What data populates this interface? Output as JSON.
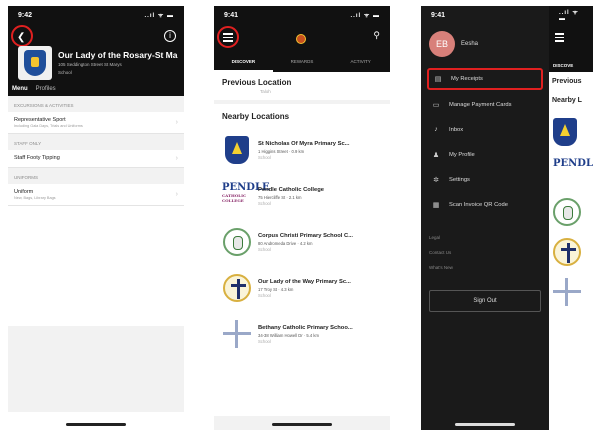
{
  "phone1": {
    "status_time": "9:42",
    "status_right": "..ıl ᯤ ▬",
    "school_name": "Our Lady of the Rosary-St Mar...",
    "school_address": "105 Seddington Street St Marys",
    "school_type": "School",
    "tabs": [
      "Menu",
      "Profiles"
    ],
    "sections": [
      {
        "header": "EXCURSIONS & ACTIVITIES",
        "rows": [
          {
            "title": "Representative Sport",
            "sub": "Including Gala Days, Trials and Uniforms"
          }
        ]
      },
      {
        "header": "STAFF ONLY",
        "rows": [
          {
            "title": "Staff Footy Tipping",
            "sub": ""
          }
        ]
      },
      {
        "header": "UNIFORMS",
        "rows": [
          {
            "title": "Uniform",
            "sub": "New, Bags, Library Bags"
          }
        ]
      }
    ]
  },
  "phone2": {
    "status_time": "9:41",
    "status_right": "..ıl ᯤ ▬",
    "tabs": [
      "DISCOVER",
      "REWARDS",
      "ACTIVITY"
    ],
    "previous_location_title": "Previous Location",
    "previous_location_sub": "Taloh",
    "nearby_title": "Nearby Locations",
    "locations": [
      {
        "name": "St Nicholas Of Myra Primary Sc...",
        "address": "1 Higgins Street · 0.9 km",
        "type": "School",
        "logo": "shield-logo"
      },
      {
        "name": "Pendle Catholic College",
        "address": "75 Hiercliffe St · 2.1 km",
        "type": "School",
        "logo": "pendle-logo"
      },
      {
        "name": "Corpus Christi Primary School C...",
        "address": "80 Andromeda Drive · 4.2 km",
        "type": "School",
        "logo": "circle-logo"
      },
      {
        "name": "Our Lady of the Way Primary Sc...",
        "address": "17 Troy St · 4.3 km",
        "type": "School",
        "logo": "cross-logo"
      },
      {
        "name": "Bethany Catholic Primary Schoo...",
        "address": "34-38 William Howell Dr · 5.4 km",
        "type": "School",
        "logo": "compass-logo"
      }
    ],
    "pendle_logo_text": "PENDLE",
    "pendle_logo_sub": "CATHOLIC COLLEGE"
  },
  "phone3": {
    "status_time": "9:41",
    "status_right": "..ıl ᯤ ▬",
    "avatar_initials": "EB",
    "profile_name": "Eesha",
    "menu": [
      {
        "label": "My Receipts",
        "icon": "receipt-icon",
        "glyph": "▤"
      },
      {
        "label": "Manage Payment Cards",
        "icon": "card-icon",
        "glyph": "▭"
      },
      {
        "label": "Inbox",
        "icon": "bell-icon",
        "glyph": "♪"
      },
      {
        "label": "My Profile",
        "icon": "person-icon",
        "glyph": "♟"
      },
      {
        "label": "Settings",
        "icon": "gear-icon",
        "glyph": "✲"
      },
      {
        "label": "Scan Invoice QR Code",
        "icon": "qr-icon",
        "glyph": "▦"
      }
    ],
    "links": [
      "Legal",
      "Contact Us",
      "What's New"
    ],
    "signout": "Sign Out",
    "behind_tab": "DISCOVE",
    "behind_title": "Previous",
    "behind_nearby": "Nearby L"
  },
  "colors": {
    "highlight": "#e02020",
    "dark_bg": "#111111",
    "drawer_bg": "#1a1a1a"
  }
}
